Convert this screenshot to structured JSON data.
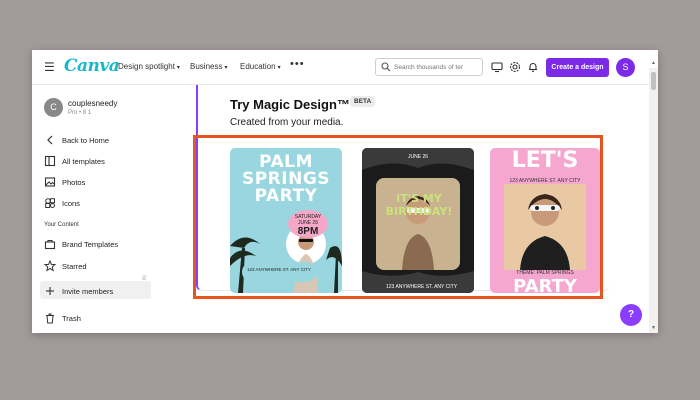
{
  "topbar": {
    "logo": "Canva",
    "nav": [
      "Design spotlight",
      "Business",
      "Education"
    ],
    "search_placeholder": "Search thousands of ter",
    "create_label": "Create a design",
    "avatar_letter": "S"
  },
  "sidebar": {
    "avatar_letter": "C",
    "username": "couplesneedy",
    "plan": "Pro • 8 1",
    "back": "Back to Home",
    "items": [
      "All templates",
      "Photos",
      "Icons"
    ],
    "section": "Your Content",
    "content_items": [
      "Brand Templates",
      "Starred"
    ],
    "invite": "Invite members",
    "trash": "Trash"
  },
  "main": {
    "title": "Try Magic Design™",
    "beta": "BETA",
    "subtitle": "Created from your media.",
    "templates": [
      {
        "head": "PALM SPRINGS PARTY",
        "date": "SATURDAY JUNE 26",
        "time": "8PM",
        "addr": "123 ANYWHERE ST. ANY CITY"
      },
      {
        "date": "JUNE 26",
        "big": "IT'S MY BIRTHDAY!",
        "addr": "123 ANYWHERE ST. ANY CITY"
      },
      {
        "head": "LET'S",
        "addr": "123 ANYWHERE ST. ANY CITY",
        "photo_label": "THEME: PALM SPRINGS",
        "foot": "PARTY"
      }
    ]
  },
  "help": "?"
}
